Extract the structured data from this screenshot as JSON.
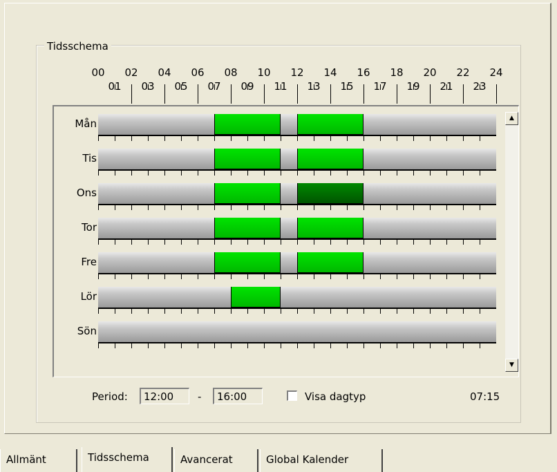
{
  "group_title": "Tidsschema",
  "hour_labels_top": [
    "00",
    "02",
    "04",
    "06",
    "08",
    "10",
    "12",
    "14",
    "16",
    "18",
    "20",
    "22",
    "24"
  ],
  "hour_labels_bottom": [
    "01",
    "03",
    "05",
    "07",
    "09",
    "11",
    "13",
    "15",
    "17",
    "19",
    "21",
    "23"
  ],
  "days": [
    {
      "label": "Mån",
      "segments": [
        {
          "start": 7,
          "end": 11,
          "dark": false
        },
        {
          "start": 12,
          "end": 16,
          "dark": false
        }
      ]
    },
    {
      "label": "Tis",
      "segments": [
        {
          "start": 7,
          "end": 11,
          "dark": false
        },
        {
          "start": 12,
          "end": 16,
          "dark": false
        }
      ]
    },
    {
      "label": "Ons",
      "segments": [
        {
          "start": 7,
          "end": 11,
          "dark": false
        },
        {
          "start": 12,
          "end": 16,
          "dark": true
        }
      ]
    },
    {
      "label": "Tor",
      "segments": [
        {
          "start": 7,
          "end": 11,
          "dark": false
        },
        {
          "start": 12,
          "end": 16,
          "dark": false
        }
      ]
    },
    {
      "label": "Fre",
      "segments": [
        {
          "start": 7,
          "end": 11,
          "dark": false
        },
        {
          "start": 12,
          "end": 16,
          "dark": false
        }
      ]
    },
    {
      "label": "Lör",
      "segments": [
        {
          "start": 8,
          "end": 11,
          "dark": false
        }
      ]
    },
    {
      "label": "Sön",
      "segments": []
    }
  ],
  "period": {
    "label": "Period:",
    "from": "12:00",
    "separator": "-",
    "to": "16:00"
  },
  "show_daytype": {
    "label": "Visa dagtyp",
    "checked": false
  },
  "time": "07:15",
  "tabs": [
    {
      "label": "Allmänt",
      "active": false
    },
    {
      "label": "Tidsschema",
      "active": true
    },
    {
      "label": "Avancerat",
      "active": false
    },
    {
      "label": "Global Kalender",
      "active": false
    }
  ],
  "colors": {
    "active_segment": "#00c800",
    "selected_segment": "#006600",
    "bar": "#b4b4b4"
  }
}
